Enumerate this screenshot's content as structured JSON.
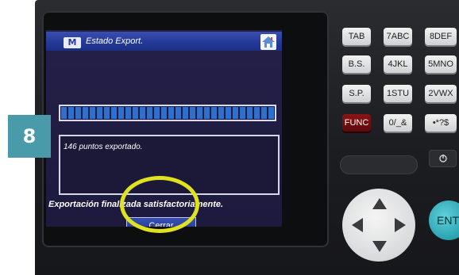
{
  "step": {
    "number": "8",
    "color": "#4a9baa"
  },
  "window": {
    "title": "Estado Export.",
    "app_icon_label": "M",
    "home_icon": "home-icon"
  },
  "progress": {
    "fraction": 1.0,
    "color": "#2f6fd0"
  },
  "message": {
    "text": "146 puntos exportado."
  },
  "status": {
    "text": "Exportación finalizada satisfactoriamente."
  },
  "close_button": {
    "label": "Cerrar"
  },
  "annotation": {
    "color": "#dfe21c",
    "shape": "circle"
  },
  "keypad": {
    "keys": [
      {
        "label": "TAB",
        "type": "normal"
      },
      {
        "label": "7ABC",
        "type": "normal"
      },
      {
        "label": "8DEF",
        "type": "normal"
      },
      {
        "label": "B.S.",
        "type": "normal"
      },
      {
        "label": "4JKL",
        "type": "normal"
      },
      {
        "label": "5MNO",
        "type": "normal"
      },
      {
        "label": "S.P.",
        "type": "normal"
      },
      {
        "label": "1STU",
        "type": "normal"
      },
      {
        "label": "2VWX",
        "type": "normal"
      },
      {
        "label": "FUNC",
        "type": "func"
      },
      {
        "label": "0/_&",
        "type": "normal"
      },
      {
        "label": "•*?$",
        "type": "normal"
      }
    ],
    "ent_label": "ENT"
  }
}
